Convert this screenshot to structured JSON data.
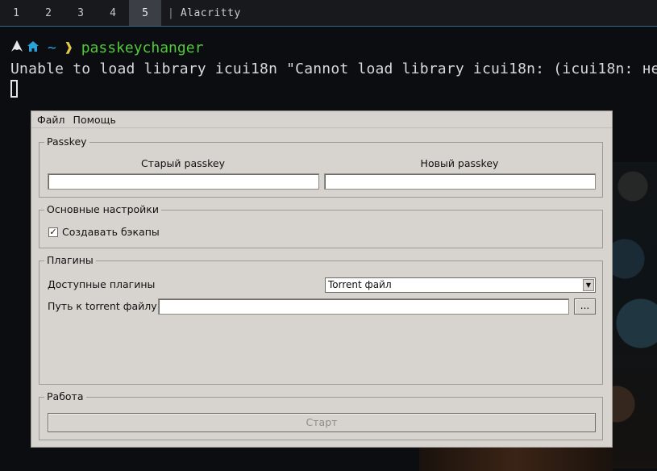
{
  "topbar": {
    "workspaces": [
      "1",
      "2",
      "3",
      "4",
      "5"
    ],
    "active_workspace": "5",
    "separator": "|",
    "window_title": "Alacritty"
  },
  "terminal": {
    "prompt_dir": "~",
    "prompt_symbol": "❱",
    "command": "passkeychanger",
    "output_line": "Unable to load library icui18n \"Cannot load library icui18n: (icui18n: не"
  },
  "dialog": {
    "menu": [
      "Файл",
      "Помощь"
    ],
    "passkey_group": {
      "title": "Passkey",
      "old_label": "Старый passkey",
      "new_label": "Новый passkey",
      "old_value": "",
      "new_value": ""
    },
    "settings_group": {
      "title": "Основные настройки",
      "backup_label": "Создавать бэкапы",
      "backup_checked": true
    },
    "plugins_group": {
      "title": "Плагины",
      "available_label": "Доступные плагины",
      "selected_plugin": "Torrent файл",
      "path_label": "Путь к torrent файлу",
      "path_value": "",
      "browse_label": "..."
    },
    "work_group": {
      "title": "Работа",
      "start_label": "Старт",
      "start_enabled": false
    }
  },
  "colors": {
    "dialog_bg": "#d7d4cf",
    "terminal_bg": "#0b0d10",
    "prompt_command": "#52c93a",
    "prompt_home": "#2ba3d8"
  }
}
